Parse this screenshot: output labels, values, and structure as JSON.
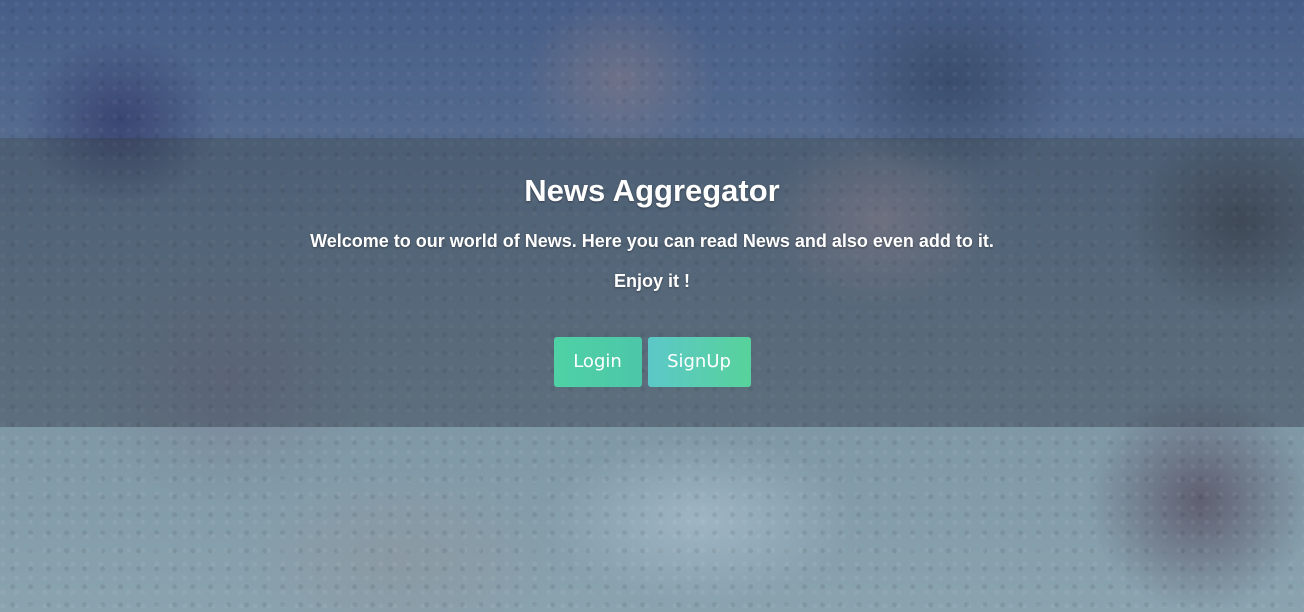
{
  "hero": {
    "title": "News Aggregator",
    "description": "Welcome to our world of News. Here you can read News and also even add to it.",
    "tagline": "Enjoy it !",
    "login_label": "Login",
    "signup_label": "SignUp"
  },
  "colors": {
    "login_button": "#4fd1a5",
    "signup_button": "#5cc8c8",
    "band_overlay": "rgba(40,45,60,0.38)"
  }
}
